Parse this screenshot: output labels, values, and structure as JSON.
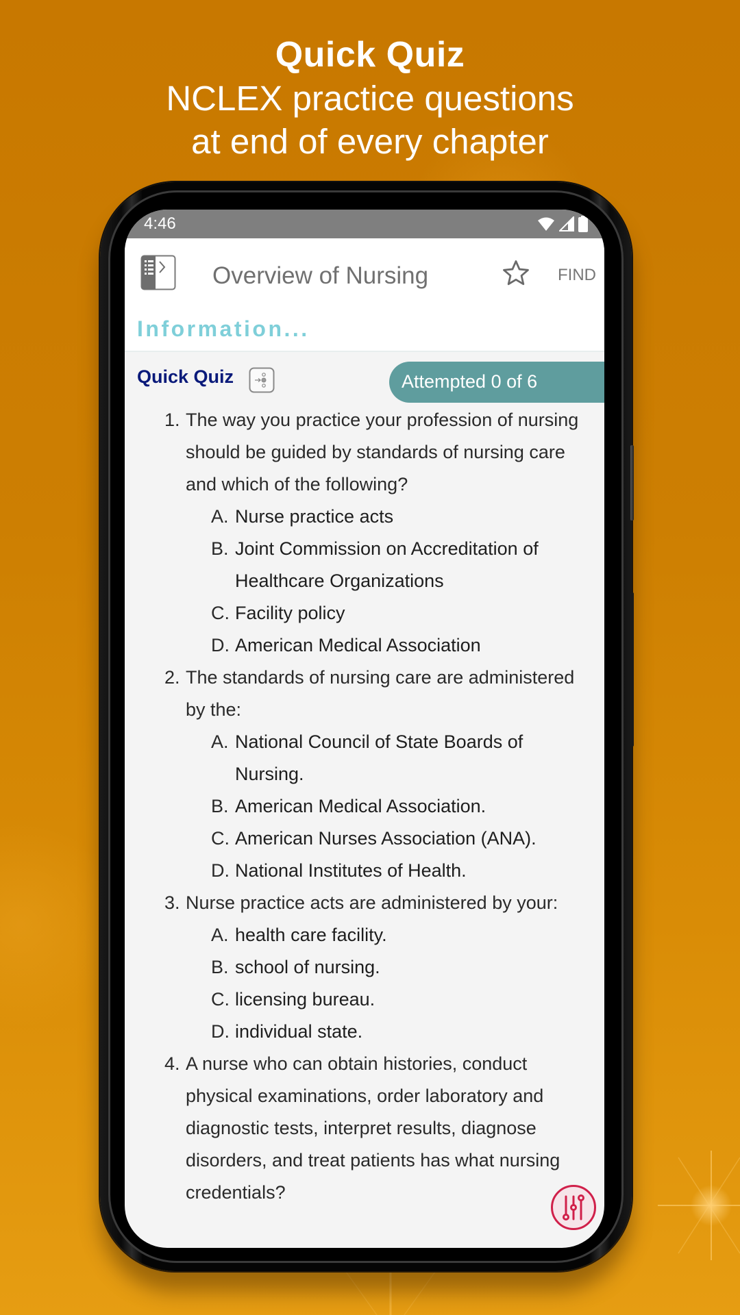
{
  "promo": {
    "title": "Quick Quiz",
    "subtitle_line1": "NCLEX practice questions",
    "subtitle_line2": "at end of every chapter"
  },
  "status_bar": {
    "time": "4:46",
    "icons": [
      "wifi-icon",
      "signal-icon",
      "battery-icon"
    ]
  },
  "app_bar": {
    "toc_icon": "table-of-contents-icon",
    "title": "Overview of Nursing",
    "bookmark_icon": "star-icon",
    "find_label": "FIND"
  },
  "info_bar": {
    "label": "Information..."
  },
  "quiz_header": {
    "label": "Quick Quiz",
    "jump_icon": "jump-to-question-icon",
    "progress_text": "Attempted 0 of 6",
    "attempted": 0,
    "total": 6
  },
  "questions": [
    {
      "number": "1.",
      "text": "The way you practice your profession of nursing should be guided by standards of nursing care and which of the following?",
      "options": [
        {
          "letter": "A.",
          "text": "Nurse practice acts"
        },
        {
          "letter": "B.",
          "text": "Joint Commission on Accreditation of Healthcare Organizations"
        },
        {
          "letter": "C.",
          "text": "Facility policy"
        },
        {
          "letter": "D.",
          "text": "American Medical Association"
        }
      ]
    },
    {
      "number": "2.",
      "text": "The standards of nursing care are administered by the:",
      "options": [
        {
          "letter": "A.",
          "text": "National Council of State Boards of Nursing."
        },
        {
          "letter": "B.",
          "text": "American Medical Association."
        },
        {
          "letter": "C.",
          "text": "American Nurses Association (ANA)."
        },
        {
          "letter": "D.",
          "text": "National Institutes of Health."
        }
      ]
    },
    {
      "number": "3.",
      "text": "Nurse practice acts are administered by your:",
      "options": [
        {
          "letter": "A.",
          "text": "health care facility."
        },
        {
          "letter": "B.",
          "text": "school of nursing."
        },
        {
          "letter": "C.",
          "text": "licensing bureau."
        },
        {
          "letter": "D.",
          "text": "individual state."
        }
      ]
    },
    {
      "number": "4.",
      "text": "A nurse who can obtain histories, conduct physical examinations, order laboratory and diagnostic tests, interpret results, diagnose disorders, and treat patients has what nursing credentials?",
      "options": []
    }
  ],
  "fab": {
    "icon": "settings-sliders-icon"
  },
  "colors": {
    "background": "#cd7f02",
    "status_bar": "#7f7f7f",
    "info_accent": "#7fcfd9",
    "quiz_title": "#0a1a7a",
    "progress_pill": "#5f9d9e",
    "fab_accent": "#d0204a"
  }
}
